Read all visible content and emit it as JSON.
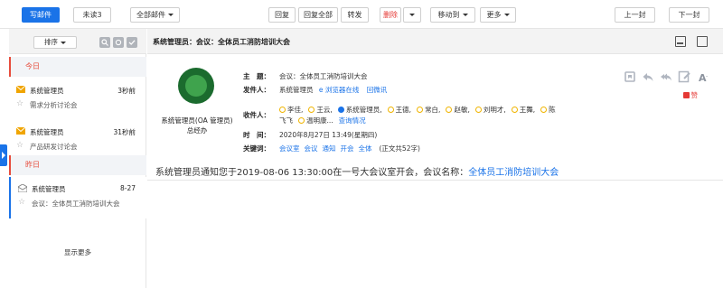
{
  "toolbar": {
    "compose": "写邮件",
    "unread": "未读3",
    "all_mail": "全部邮件",
    "reply": "回复",
    "reply_all": "回复全部",
    "forward": "转发",
    "delete": "删除",
    "move_to": "移动到",
    "more": "更多",
    "prev": "上一封",
    "next": "下一封"
  },
  "list": {
    "sort": "排序",
    "groups": {
      "today": "今日",
      "yesterday": "昨日"
    },
    "mails": [
      {
        "from": "系统管理员",
        "time": "3秒前",
        "subject": "需求分析讨论会"
      },
      {
        "from": "系统管理员",
        "time": "31秒前",
        "subject": "产品研发讨论会"
      },
      {
        "from": "系统管理员",
        "time": "8-27",
        "subject": "会议：全体员工消防培训大会"
      }
    ],
    "show_more": "显示更多"
  },
  "detail": {
    "subject_bar": "系统管理员：会议：全体员工消防培训大会",
    "sender_card": {
      "name": "系统管理员(OA 管理员)",
      "dept": "总经办"
    },
    "labels": {
      "subject": "主　题：",
      "sender": "发件人：",
      "recipients": "收件人：",
      "time": "时　间：",
      "keywords": "关键词："
    },
    "subject": "会议：全体员工消防培训大会",
    "sender": "系统管理员",
    "browser_online": "浏览器在线",
    "wechat": "回微讯",
    "recipients_line1": [
      "李佳,",
      "王云,",
      "系统管理员,",
      "王德,",
      "常白,",
      "赵敏,",
      "刘明才,",
      "王舞,",
      "陈"
    ],
    "recipients_line2_a": "飞飞",
    "recipients_line2_b": "温明康...",
    "view_status": "查询情况",
    "time": "2020年8月27日 13:49(星期四)",
    "keywords": [
      "会议室",
      "会议",
      "通知",
      "开会",
      "全体"
    ],
    "word_count": "(正文共52字)",
    "like": "赞",
    "body_prefix": "系统管理员通知您于2019-08-06 13:30:00在一号大会议室开会，会议名称：",
    "body_link": "全体员工消防培训大会"
  },
  "colors": {
    "accent": "#1a73e8",
    "danger": "#e53935",
    "avatar": "#1b6b2e"
  }
}
